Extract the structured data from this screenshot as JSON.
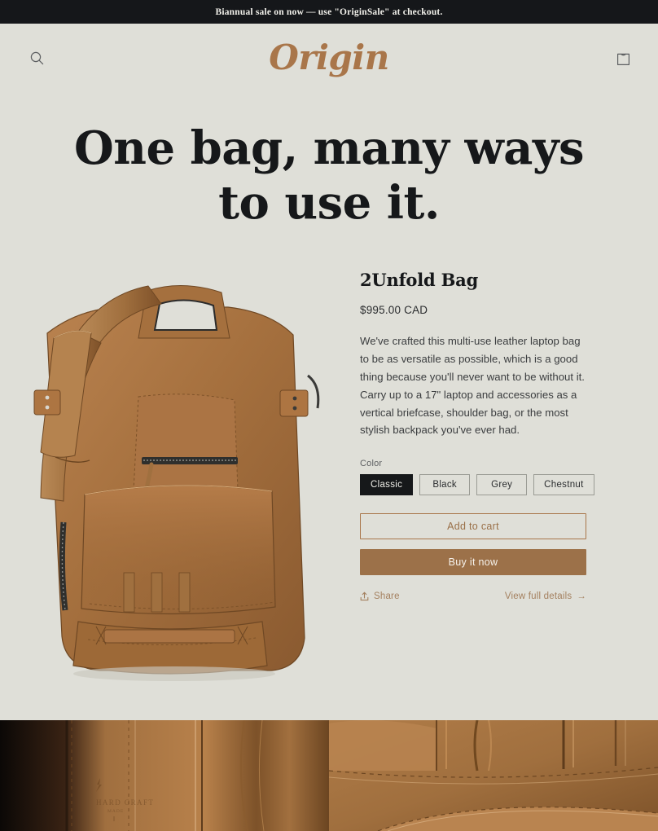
{
  "announcement": {
    "text": "Biannual sale on now — use \"OriginSale\" at checkout."
  },
  "header": {
    "logo": "Origin",
    "search_icon": "search-icon",
    "cart_icon": "shopping-bag-icon"
  },
  "hero": {
    "title_line1": "One bag, many ways",
    "title_line2": "to use it."
  },
  "product": {
    "title": "2Unfold Bag",
    "price": "$995.00 CAD",
    "description": "We've crafted this multi-use leather laptop bag to be as versatile as possible, which is a good thing because you'll never want to be without it. Carry up to a 17\" laptop and accessories as a vertical briefcase, shoulder bag, or the most stylish backpack you've ever had.",
    "option_label": "Color",
    "options": [
      {
        "label": "Classic",
        "selected": true
      },
      {
        "label": "Black",
        "selected": false
      },
      {
        "label": "Grey",
        "selected": false
      },
      {
        "label": "Chestnut",
        "selected": false
      }
    ],
    "add_to_cart_label": "Add to cart",
    "buy_now_label": "Buy it now",
    "share_label": "Share",
    "details_label": "View full details",
    "details_arrow": "→",
    "image_alt": "Brown leather 2Unfold backpack with shoulder strap"
  },
  "gallery": {
    "left_alt": "Close-up of leather side panel with HARD GRAFT embossed branding",
    "left_brand": "HARD GRAFT",
    "left_brand_sub": "MADE",
    "right_alt": "Close-up of stitched leather pockets and folds"
  },
  "colors": {
    "background": "#dfdfd8",
    "announcement_bg": "#15171a",
    "accent": "#a9764a",
    "buy_button": "#9c7149",
    "text_dark": "#16181a",
    "leather": "#a9703f"
  }
}
